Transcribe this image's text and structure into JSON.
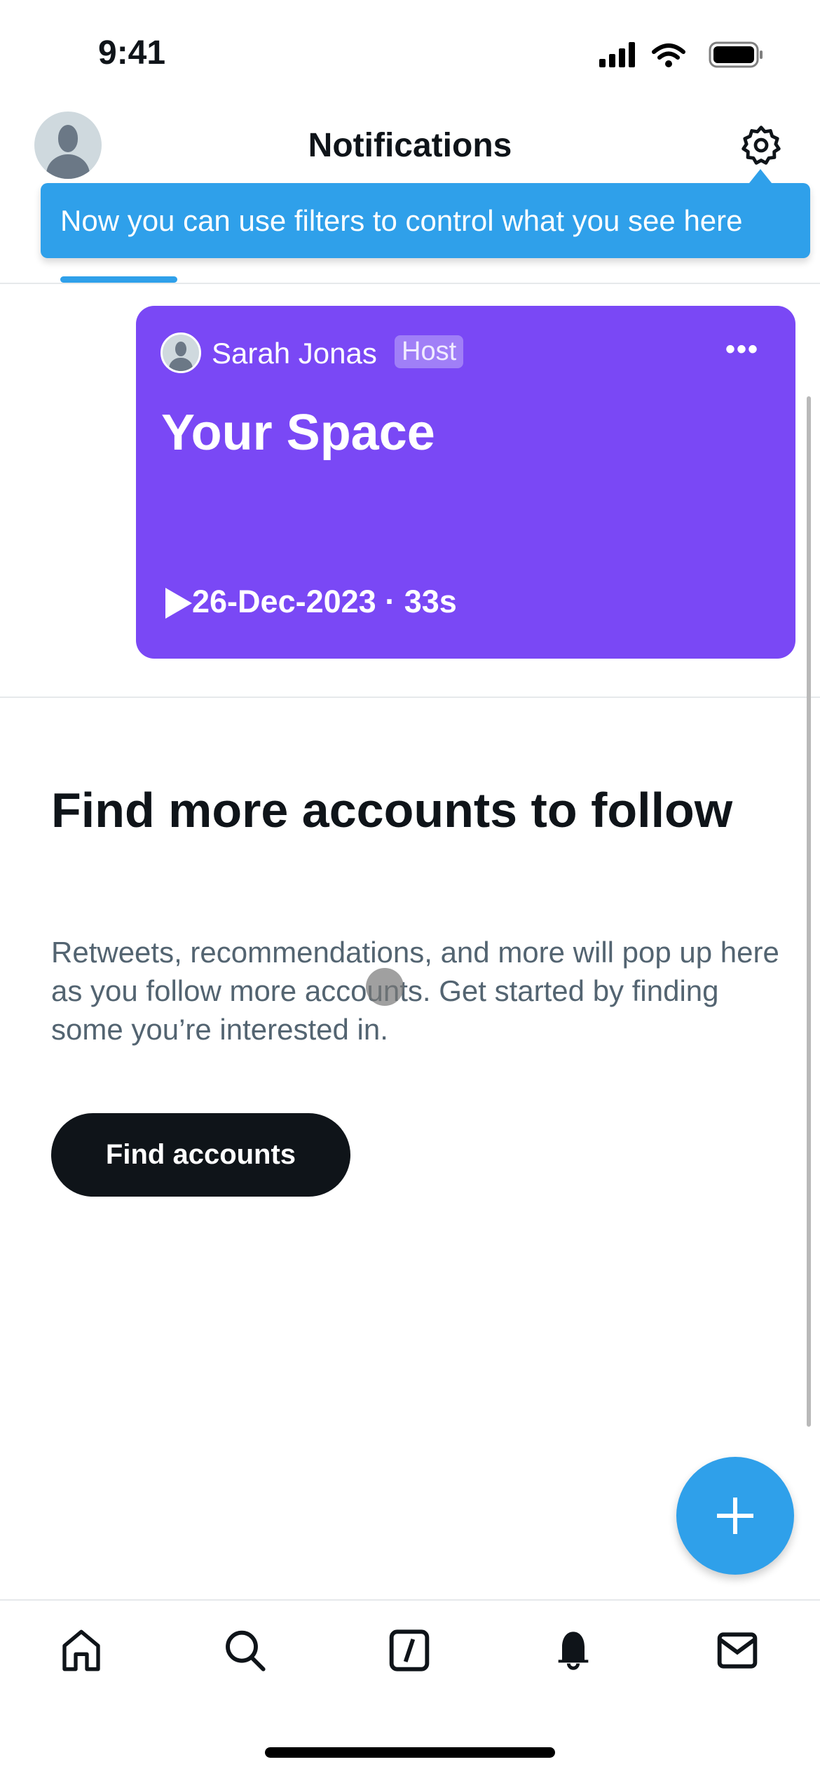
{
  "status_bar": {
    "time": "9:41"
  },
  "header": {
    "title": "Notifications"
  },
  "tooltip": {
    "text": "Now you can use filters to control what you see here"
  },
  "space_card": {
    "host_name": "Sarah Jonas",
    "host_badge": "Host",
    "title": "Your Space",
    "date": "26-Dec-2023",
    "separator": "·",
    "duration": "33s",
    "color": "#7a48f5"
  },
  "empty_state": {
    "heading": "Find more accounts to follow",
    "body": "Retweets, recommendations, and more will pop up here as you follow more accounts. Get started by finding some you’re interested in.",
    "button_label": "Find accounts"
  },
  "accent_color": "#2fa0ea",
  "bottom_nav": [
    "home-icon",
    "search-icon",
    "spaces-icon",
    "notifications-icon",
    "messages-icon"
  ],
  "active_nav": "notifications-icon"
}
